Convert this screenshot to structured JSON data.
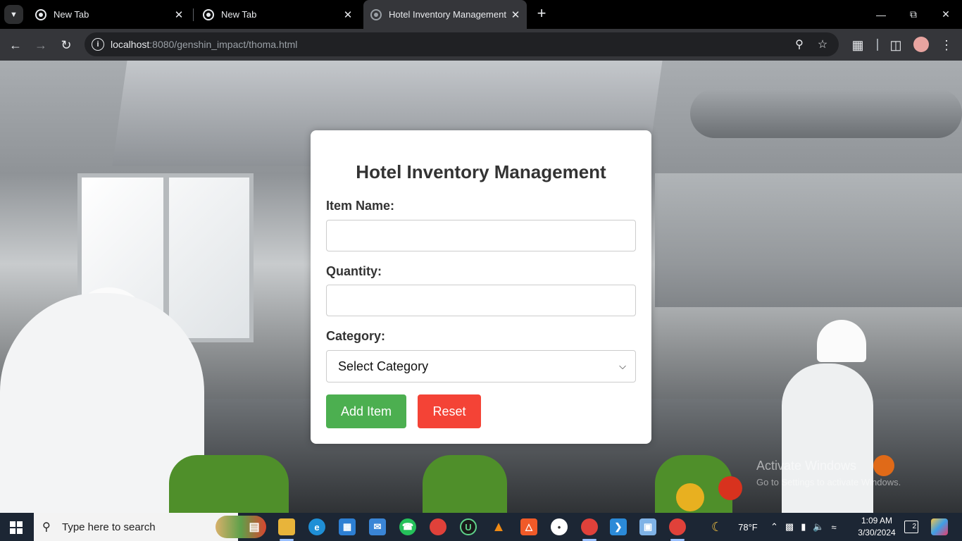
{
  "browser": {
    "tabs": [
      {
        "title": "New Tab"
      },
      {
        "title": "New Tab"
      },
      {
        "title": "Hotel Inventory Management"
      }
    ],
    "url_host": "localhost",
    "url_rest": ":8080/genshin_impact/thoma.html"
  },
  "form": {
    "title": "Hotel Inventory Management",
    "item_name_label": "Item Name:",
    "item_name_value": "",
    "quantity_label": "Quantity:",
    "quantity_value": "",
    "category_label": "Category:",
    "category_selected": "Select Category",
    "add_button": "Add Item",
    "reset_button": "Reset"
  },
  "watermark": {
    "title": "Activate Windows",
    "subtitle": "Go to Settings to activate Windows."
  },
  "taskbar": {
    "search_placeholder": "Type here to search",
    "weather": "78°F",
    "time": "1:09 AM",
    "date": "3/30/2024",
    "notification_count": "2"
  },
  "colors": {
    "add_button": "#4caf50",
    "reset_button": "#f44336",
    "card_background": "#ffffff",
    "taskbar": "#1c2634",
    "browser_frame": "#35363a"
  }
}
